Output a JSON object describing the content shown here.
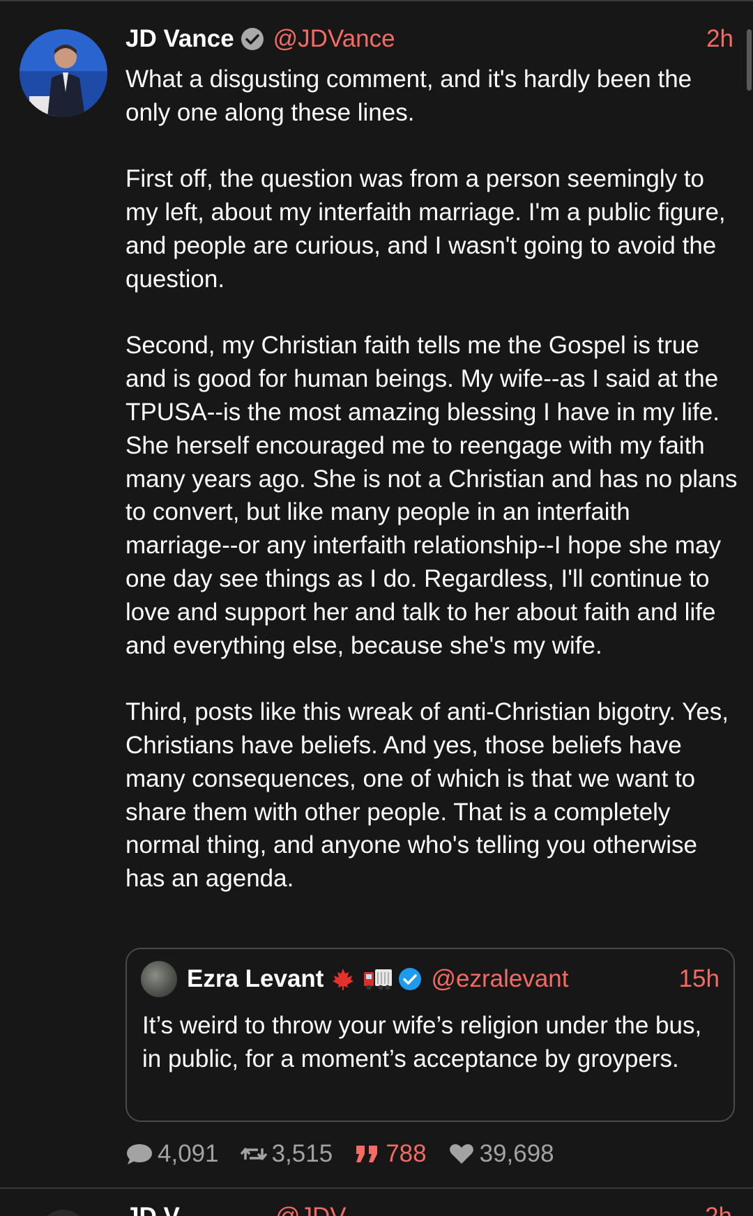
{
  "post": {
    "author": {
      "name": "JD Vance",
      "handle": "@JDVance",
      "badge": "grey-check-icon"
    },
    "time": "2h",
    "body": "What a disgusting comment, and it's hardly been the only one along these lines.\n\nFirst off, the question was from a person seemingly to my left, about my interfaith marriage. I'm a public figure, and people are curious, and I wasn't going to avoid the question.\n\nSecond, my Christian faith tells me the Gospel is true and is good for human beings. My wife--as I said at the TPUSA--is the most amazing blessing I have in my life. She herself encouraged me to reengage with my faith many years ago. She is not a Christian and has no plans to convert, but like many people in an interfaith marriage--or any interfaith relationship--I hope she may one day see things as I do. Regardless, I'll continue to love and support her and talk to her about faith and life and everything else, because she's my wife.\n\nThird, posts like this wreak of anti-Christian bigotry. Yes, Christians have beliefs. And yes, those beliefs have many consequences, one of which is that we want to share them with other people. That is a completely normal thing, and anyone who's telling you otherwise has an agenda.",
    "quoted": {
      "author": {
        "name": "Ezra Levant",
        "emojis": [
          "maple-leaf-icon",
          "truck-icon"
        ],
        "badge": "blue-verified-icon",
        "handle": "@ezralevant"
      },
      "time": "15h",
      "body": "It’s weird to throw your wife’s religion under the bus, in public, for a moment’s acceptance by groypers."
    },
    "stats": {
      "replies": "4,091",
      "reposts": "3,515",
      "quotes": "788",
      "likes": "39,698"
    }
  },
  "next_post": {
    "name": "JD V",
    "handle": "@JDV",
    "time": "2h"
  },
  "colors": {
    "background": "#171717",
    "accent": "#f36b63",
    "muted": "#a3a3a3",
    "verified_blue": "#1d9bf0"
  }
}
